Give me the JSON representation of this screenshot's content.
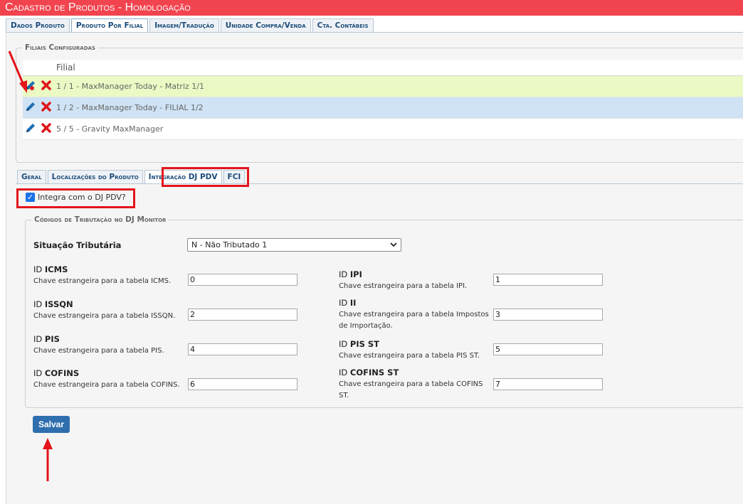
{
  "title": "Cadastro de Produtos  - Homologação",
  "main_tabs": [
    {
      "label": "Dados Produto"
    },
    {
      "label": "Produto Por Filial"
    },
    {
      "label": "Imagem/Tradução"
    },
    {
      "label": "Unidade Compra/Venda"
    },
    {
      "label": "Cta. Contábeis"
    }
  ],
  "filiais": {
    "legend": "Filiais Configuradas",
    "column": "Filial",
    "rows": [
      {
        "text": "1 / 1 - MaxManager Today - Matriz 1/1"
      },
      {
        "text": "1 / 2 - MaxManager Today - FILIAL 1/2"
      },
      {
        "text": "5 / 5 - Gravity MaxManager"
      }
    ]
  },
  "sub_tabs": [
    {
      "label": "Geral"
    },
    {
      "label": "Localizações do Produto"
    },
    {
      "label": "Integração DJ PDV"
    },
    {
      "label": "FCI"
    }
  ],
  "integra_checkbox": {
    "label": "Integra com o DJ PDV?",
    "checked": true
  },
  "tributacao": {
    "legend": "Códigos de Tributação no DJ Monitor",
    "situacao_label": "Situação Tributária",
    "situacao_value": "N - Não Tributado 1",
    "id_prefix": "ID",
    "fields": {
      "icms": {
        "name": "ICMS",
        "hint": "Chave estrangeira para a tabela ICMS.",
        "value": "0"
      },
      "issqn": {
        "name": "ISSQN",
        "hint": "Chave estrangeira para a tabela ISSQN.",
        "value": "2"
      },
      "pis": {
        "name": "PIS",
        "hint": "Chave estrangeira para a tabela PIS.",
        "value": "4"
      },
      "cofins": {
        "name": "COFINS",
        "hint": "Chave estrangeira para a tabela COFINS.",
        "value": "6"
      },
      "ipi": {
        "name": "IPI",
        "hint": "Chave estrangeira para a tabela IPI.",
        "value": "1"
      },
      "ii": {
        "name": "II",
        "hint_1": "Chave estrangeira para a tabela Impostos",
        "hint_2": "de Importação.",
        "value": "3"
      },
      "pis_st": {
        "name": "PIS ST",
        "hint": "Chave estrangeira para a tabela PIS ST.",
        "value": "5"
      },
      "cofins_st": {
        "name": "COFINS ST",
        "hint_1": "Chave estrangeira para a tabela COFINS",
        "hint_2": "ST.",
        "value": "7"
      }
    }
  },
  "save_label": "Salvar",
  "colors": {
    "title_bar": "#f2444f",
    "annotation": "#e3141b",
    "row_selected": "#ebfac4",
    "row_hover": "#cfe3f4",
    "button": "#2f6fae"
  }
}
